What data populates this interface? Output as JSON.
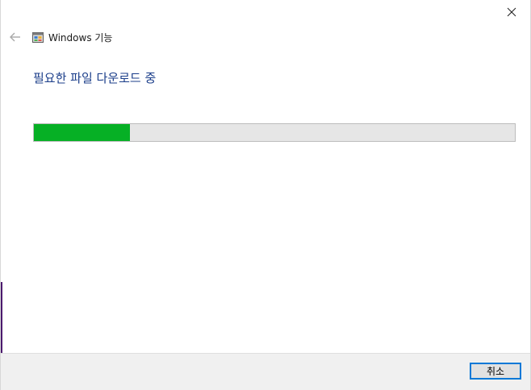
{
  "window": {
    "title": "Windows 기능"
  },
  "main": {
    "heading": "필요한 파일 다운로드 중",
    "progress_fraction": 0.2
  },
  "footer": {
    "cancel_label": "취소"
  },
  "icons": {
    "close": "close-icon",
    "back": "back-arrow-icon",
    "app": "windows-features-icon"
  },
  "colors": {
    "heading": "#1b3e8a",
    "progress_fill": "#06b025",
    "progress_track": "#e6e6e6",
    "accent_border": "#0078d7"
  }
}
